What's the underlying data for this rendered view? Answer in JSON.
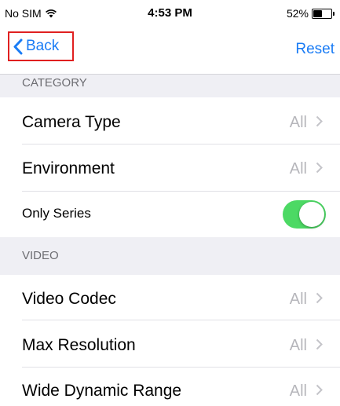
{
  "status_bar": {
    "carrier": "No SIM",
    "time": "4:53 PM",
    "battery_text": "52%",
    "battery_level": 0.52
  },
  "nav": {
    "back_label": "Back",
    "reset_label": "Reset"
  },
  "sections": {
    "category": {
      "header": "CATEGORY",
      "rows": {
        "camera_type": {
          "label": "Camera Type",
          "value": "All"
        },
        "environment": {
          "label": "Environment",
          "value": "All"
        },
        "only_series": {
          "label": "Only Series",
          "on": true
        }
      }
    },
    "video": {
      "header": "VIDEO",
      "rows": {
        "video_codec": {
          "label": "Video Codec",
          "value": "All"
        },
        "max_resolution": {
          "label": "Max Resolution",
          "value": "All"
        },
        "wdr": {
          "label": "Wide Dynamic Range",
          "value": "All"
        }
      }
    }
  },
  "colors": {
    "accent": "#1a7cf5",
    "toggle_on": "#4cd964",
    "highlight_border": "#e02020"
  }
}
